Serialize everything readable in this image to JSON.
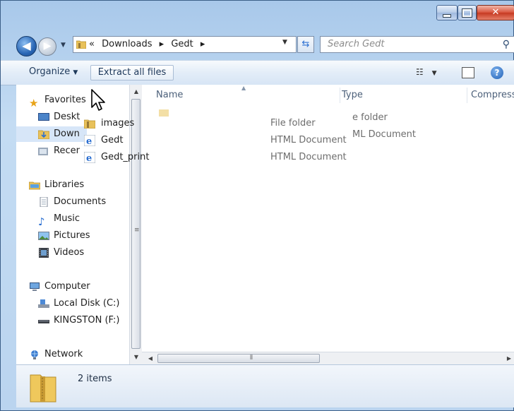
{
  "window": {
    "minimize_glyph": "min",
    "maximize_glyph": "max",
    "close_glyph": "✕"
  },
  "nav": {
    "back_glyph": "◀",
    "forward_glyph": "▶",
    "breadcrumb": [
      "«",
      "Downloads",
      "▸",
      "Gedt",
      "▸"
    ],
    "search_placeholder": "Search Gedt"
  },
  "toolbar": {
    "organize_label": "Organize",
    "extract_label": "Extract all files"
  },
  "sidebar": {
    "favorites_label": "Favorites",
    "favorites_items": [
      "Deskt",
      "Down",
      "Recer"
    ],
    "libraries_label": "Libraries",
    "libraries_items": [
      "Documents",
      "Music",
      "Pictures",
      "Videos"
    ],
    "computer_label": "Computer",
    "computer_items": [
      "Local Disk (C:)",
      "KINGSTON (F:)"
    ],
    "network_label": "Network"
  },
  "columns": {
    "name": "Name",
    "type": "Type",
    "compressed": "Compress"
  },
  "background_rows": [
    {
      "type": "e folder"
    },
    {
      "type": "ML Document"
    }
  ],
  "dragged_items": [
    {
      "name": "images",
      "type": "File folder",
      "icon": "folder-icon"
    },
    {
      "name": "Gedt",
      "type": "HTML Document",
      "icon": "ie-html-icon"
    },
    {
      "name": "Gedt_print",
      "type": "HTML Document",
      "icon": "ie-html-icon"
    }
  ],
  "status": {
    "count_text": "2 items"
  },
  "colors": {
    "accent": "#2b6fd1",
    "titlebar": "#bad4ef",
    "close": "#d9563f"
  }
}
